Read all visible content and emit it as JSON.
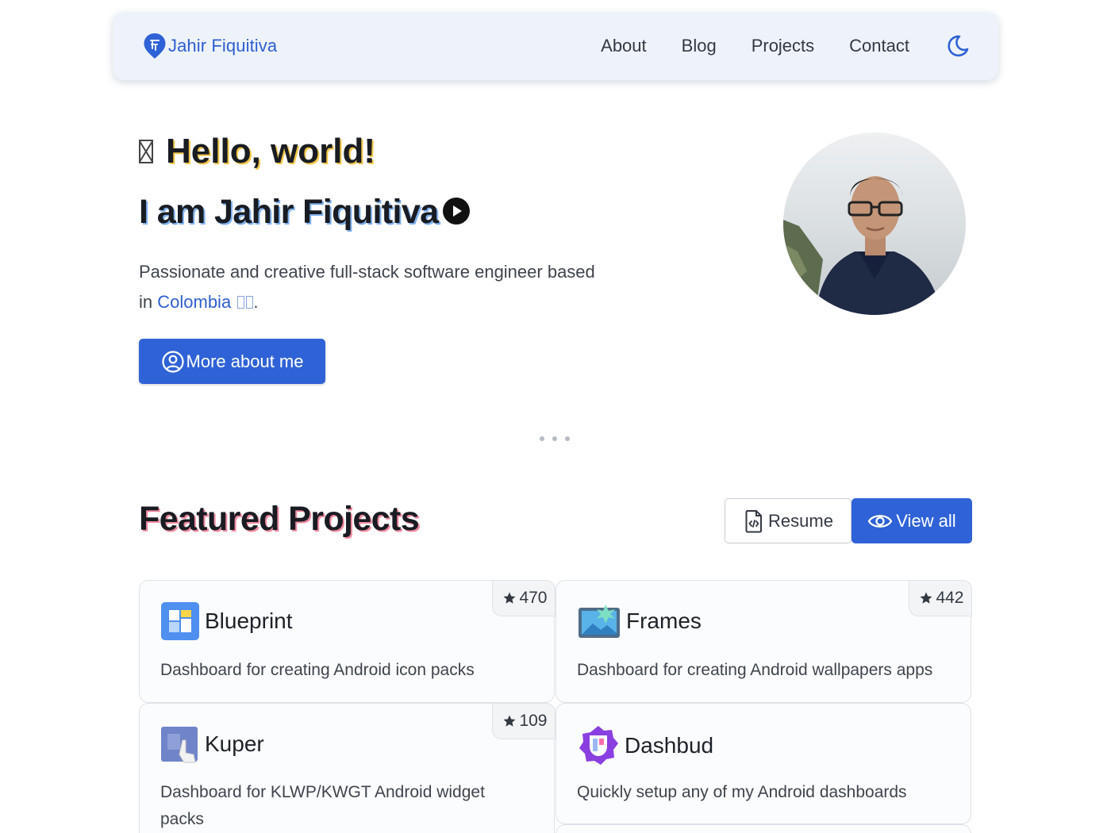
{
  "header": {
    "brand": "Jahir Fiquitiva",
    "nav": [
      "About",
      "Blog",
      "Projects",
      "Contact"
    ]
  },
  "hero": {
    "greeting": "Hello, world!",
    "title": "I am Jahir Fiquitiva",
    "tagline_pre": "Passionate and creative full-stack software engineer based in",
    "tagline_link": "Colombia",
    "tagline_post": ".",
    "cta": "More about me"
  },
  "featured": {
    "title": "Featured Projects",
    "resume_label": "Resume",
    "view_all_label": "View all",
    "projects": [
      {
        "name": "Blueprint",
        "description": "Dashboard for creating Android icon packs",
        "stars": "470"
      },
      {
        "name": "Frames",
        "description": "Dashboard for creating Android wallpapers apps",
        "stars": "442"
      },
      {
        "name": "Kuper",
        "description": "Dashboard for KLWP/KWGT Android widget packs",
        "stars": "109"
      },
      {
        "name": "Dashbud",
        "description": "Quickly setup any of my Android dashboards"
      }
    ]
  },
  "colors": {
    "accent": "#2f62d6",
    "header_bg": "#eef3fb",
    "greeting_shadow": "#f3c74a",
    "name_shadow": "#7fb1ef",
    "section_shadow": "#f08aa0"
  },
  "icons": {
    "brand": "map-pin-logo-icon",
    "theme": "moon-icon",
    "play": "play-circle-icon",
    "cta": "user-circle-icon",
    "resume": "file-code-icon",
    "view_all": "eye-icon",
    "stars": "star-icon"
  }
}
